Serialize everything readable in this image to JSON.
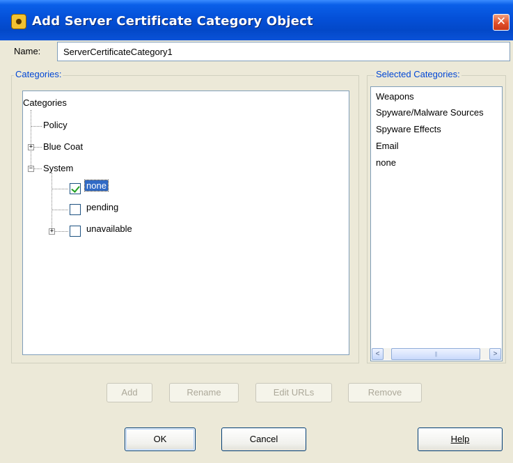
{
  "window": {
    "title": "Add Server Certificate Category Object",
    "close_glyph": "✕",
    "icon": "settings-gear-icon"
  },
  "name_field": {
    "label": "Name:",
    "value": "ServerCertificateCategory1"
  },
  "categories_group": {
    "legend": "Categories:",
    "root": "Categories",
    "items": [
      "Policy",
      "Blue Coat",
      "System"
    ],
    "system_children": [
      {
        "label": "none",
        "checked": true,
        "selected": true
      },
      {
        "label": "pending",
        "checked": false
      },
      {
        "label": "unavailable",
        "checked": false,
        "expandable": true
      }
    ]
  },
  "selected_group": {
    "legend": "Selected Categories:",
    "items": [
      "Weapons",
      "Spyware/Malware Sources",
      "Spyware Effects",
      "Email",
      "none"
    ]
  },
  "scrollbar": {
    "left_arrow": "<",
    "right_arrow": ">",
    "thumb_grip": "|||"
  },
  "action_buttons": {
    "add": "Add",
    "rename": "Rename",
    "edit_urls": "Edit URLs",
    "remove": "Remove"
  },
  "footer_buttons": {
    "ok": "OK",
    "cancel": "Cancel",
    "help": "Help"
  },
  "tree_glyphs": {
    "plus": "+",
    "minus": "−"
  },
  "colors": {
    "title_bar": "#0450d8",
    "legend_text": "#0046d5",
    "selection": "#316ac5"
  }
}
